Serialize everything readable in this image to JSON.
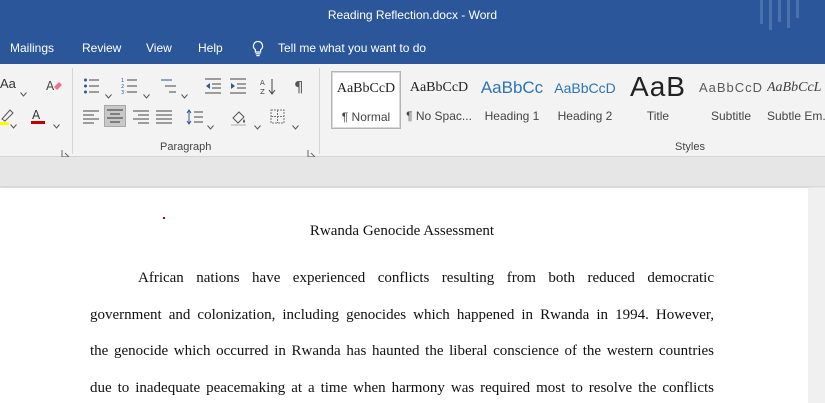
{
  "window": {
    "title": "Reading Reflection.docx  -  Word"
  },
  "menu": {
    "tabs": [
      "Mailings",
      "Review",
      "View",
      "Help"
    ],
    "tell_me": "Tell me what you want to do"
  },
  "ribbon": {
    "font_size_label": "Aa",
    "paragraph_group_label": "Paragraph",
    "styles_group_label": "Styles",
    "styles": [
      {
        "sample": "AaBbCcD",
        "name": "¶ Normal",
        "selected": true
      },
      {
        "sample": "AaBbCcD",
        "name": "¶ No Spac..."
      },
      {
        "sample": "AaBbCc",
        "name": "Heading 1"
      },
      {
        "sample": "AaBbCcD",
        "name": "Heading 2"
      },
      {
        "sample": "AaB",
        "name": "Title"
      },
      {
        "sample": "AaBbCcD",
        "name": "Subtitle"
      },
      {
        "sample": "AaBbCcL",
        "name": "Subtle Em..."
      }
    ],
    "colors": {
      "highlight": "#ffff00",
      "font_color": "#c00000",
      "accent": "#2b579a",
      "heading_blue": "#2e74b5"
    }
  },
  "document": {
    "title": "Rwanda Genocide Assessment",
    "lines": [
      "African nations have experienced conflicts resulting from both reduced democratic",
      "government and colonization, including genocides which happened in Rwanda in 1994. However,",
      "the genocide which occurred in Rwanda has haunted the liberal conscience of the western countries",
      "due to inadequate peacemaking at a time when harmony was required most to resolve the conflicts"
    ]
  }
}
